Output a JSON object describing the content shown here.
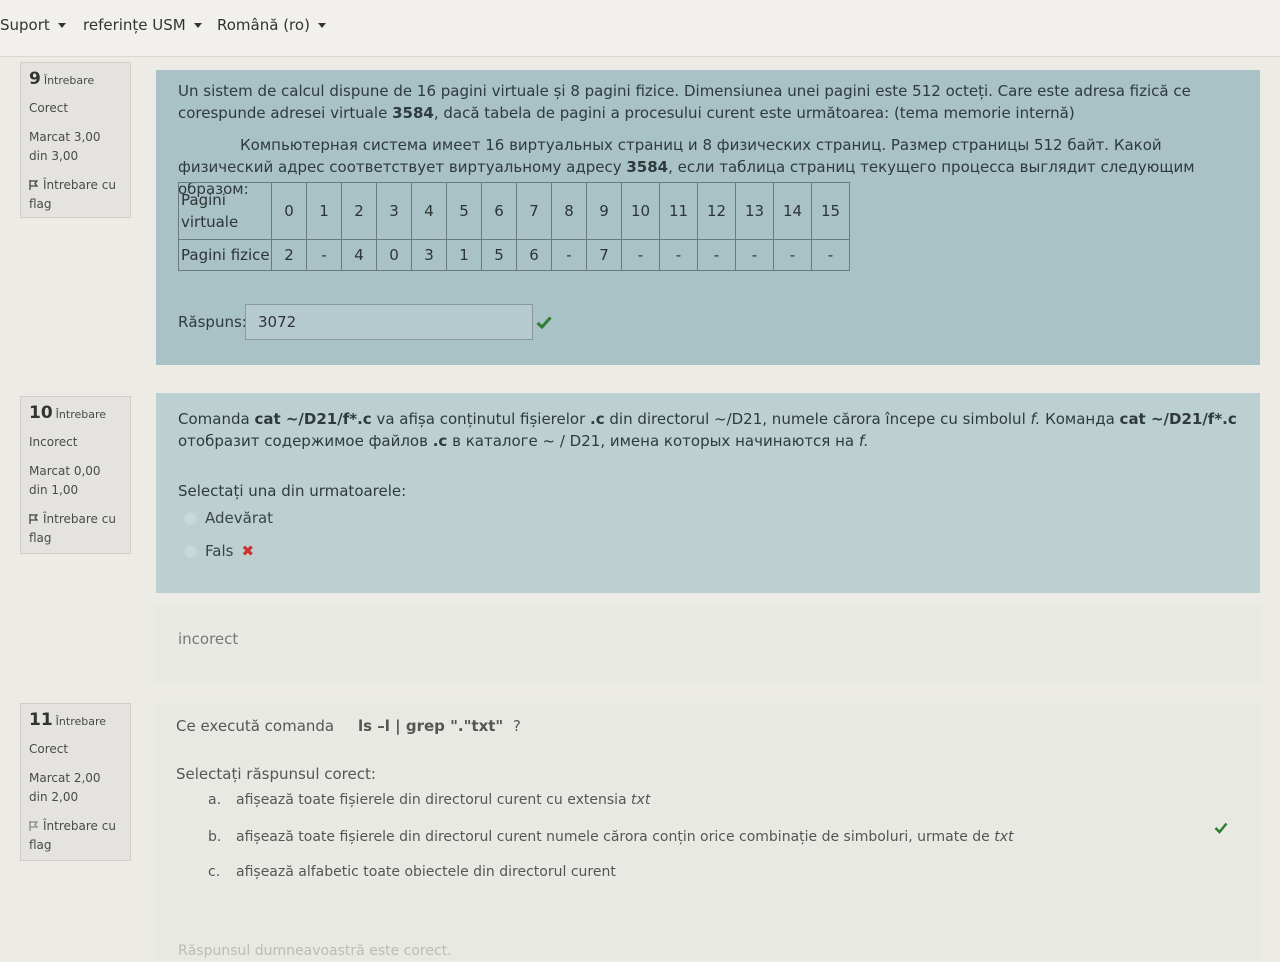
{
  "nav": {
    "items": [
      {
        "label": "Suport"
      },
      {
        "label": "referințe USM"
      },
      {
        "label": "Română (ro)"
      }
    ]
  },
  "q9": {
    "number": "9",
    "word": "Întrebare",
    "status": "Corect",
    "mark": "Marcat 3,00 din 3,00",
    "flag": "Întrebare cu flag",
    "text_ro_a": "Un sistem de calcul dispune de 16 pagini virtuale și 8 pagini fizice. Dimensiunea unei pagini este 512 octeți. Care este adresa fizică ce corespunde adresei virtuale ",
    "text_ro_bold": "3584",
    "text_ro_b": ", dacă tabela de pagini a procesului curent este următoarea:   (tema memorie internă)",
    "text_ru_a": "Компьютерная система имеет 16 виртуальных страниц и 8 физических страниц. Размер страницы 512 байт. Какой физический адрес соответствует виртуальному адресу ",
    "text_ru_bold": "3584",
    "text_ru_b": ", если таблица страниц текущего процесса выглядит следующим образом:",
    "table": {
      "row1_header": "Pagini virtuale",
      "row2_header": "Pagini fizice",
      "virtual": [
        "0",
        "1",
        "2",
        "3",
        "4",
        "5",
        "6",
        "7",
        "8",
        "9",
        "10",
        "11",
        "12",
        "13",
        "14",
        "15"
      ],
      "physical": [
        "2",
        "-",
        "4",
        "0",
        "3",
        "1",
        "5",
        "6",
        "-",
        "7",
        "-",
        "-",
        "-",
        "-",
        "-",
        "-"
      ]
    },
    "answer_label": "Răspuns:",
    "answer_value": "3072"
  },
  "q10": {
    "number": "10",
    "word": "Întrebare",
    "status": "Incorect",
    "mark": "Marcat 0,00 din 1,00",
    "flag": "Întrebare cu flag",
    "t1": "Comanda ",
    "t1b": "cat  ~/D21/f*.c",
    "t2": " va afișa conținutul fișierelor ",
    "t2b": ".c",
    "t3": " din directorul ~/D21, numele cărora începe cu simbolul ",
    "t3i": "f.",
    "t4": "  Команда ",
    "t4b": "cat  ~/D21/f*.c",
    "t5": " отобразит содержимое файлов ",
    "t5b": ".c",
    "t6": " в каталоге ~ / D21, имена которых начинаются на ",
    "t6i": "f.",
    "prompt": "Selectați una din urmatoarele:",
    "options": [
      "Adevărat",
      "Fals"
    ],
    "feedback": "incorect"
  },
  "q11": {
    "number": "11",
    "word": "Întrebare",
    "status": "Corect",
    "mark": "Marcat 2,00 din 2,00",
    "flag": "Întrebare cu flag",
    "text": "Ce execută comanda",
    "command": "ls –l | grep \".\"txt\"",
    "qmark": "?",
    "prompt": "Selectați răspunsul corect:",
    "options": [
      {
        "letter": "a.",
        "text": "afișează toate fișierele din directorul curent cu extensia ",
        "ital": "txt"
      },
      {
        "letter": "b.",
        "text": "afișează toate fișierele din directorul curent numele cărora conțin orice combinație de simboluri, urmate de ",
        "ital": "txt"
      },
      {
        "letter": "c.",
        "text": "afișează alfabetic toate obiectele din directorul curent",
        "ital": ""
      }
    ],
    "feedback": "Răspunsul dumneavoastră este corect."
  },
  "colors": {
    "page_bg": "#ecebe6",
    "question_bg": "#a9c2c6",
    "correct_check": "#2e7d32",
    "incorrect_x": "#d0312d"
  }
}
